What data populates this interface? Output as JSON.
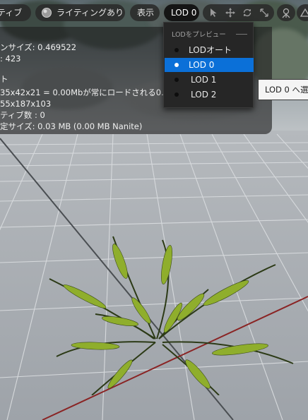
{
  "toolbar": {
    "mode_tab_label": "ティブ",
    "lighting_label": "ライティングあり",
    "show_label": "表示",
    "lod_label": "LOD 0"
  },
  "stats": [
    "ンサイズ: 0.469522",
    ": 423",
    "ト",
    "35x42x21 = 0.00Mbが常にロードされる0.0",
    "55x187x103",
    "ティブ数 : 0",
    "定サイズ: 0.03 MB (0.00 MB Nanite)"
  ],
  "lod_menu": {
    "header": "LODをプレビュー",
    "items": [
      {
        "label": "LODオート",
        "selected": false
      },
      {
        "label": "LOD 0",
        "selected": true
      },
      {
        "label": "LOD 1",
        "selected": false
      },
      {
        "label": "LOD 2",
        "selected": false
      }
    ]
  },
  "tooltip": "LOD 0 へ選",
  "colors": {
    "menu_selected": "#0b70d8",
    "panel_bg": "#262626",
    "x_axis": "#8a2424"
  },
  "icons": [
    "lighting-sphere-icon",
    "select-arrow-icon",
    "move-icon",
    "rotate-icon",
    "scale-icon",
    "surface-snapping-icon",
    "camera-speed-icon"
  ]
}
